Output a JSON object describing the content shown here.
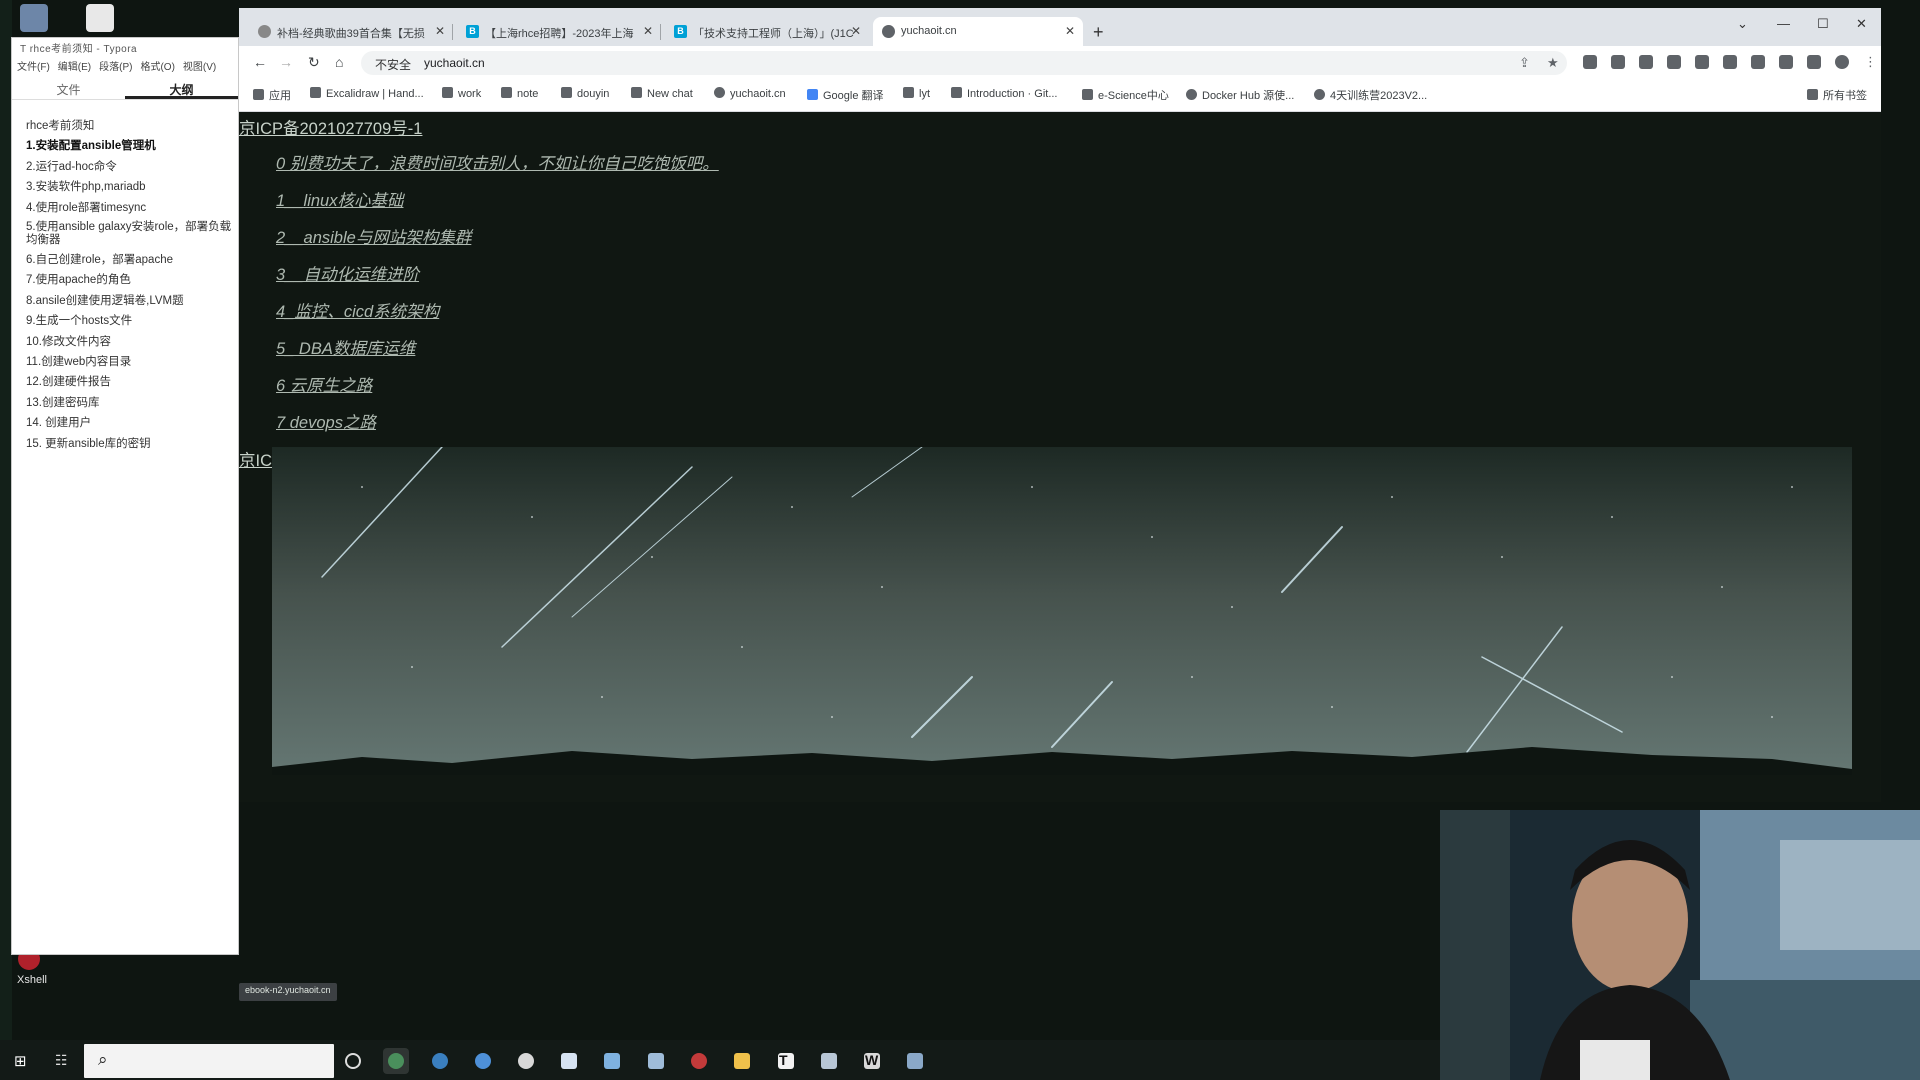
{
  "desktop": {
    "icons": [
      {
        "name": "recycle-bin-icon"
      },
      {
        "name": "document-icon"
      },
      {
        "name": "xshell-icon",
        "label": "Xshell"
      }
    ]
  },
  "typora": {
    "title": "T rhce考前须知 - Typora",
    "menu": [
      "文件(F)",
      "编辑(E)",
      "段落(P)",
      "格式(O)",
      "视图(V)"
    ],
    "tabs": {
      "files": "文件",
      "outline": "大纲"
    },
    "outline": [
      "rhce考前须知",
      "1.安装配置ansible管理机",
      "2.运行ad-hoc命令",
      "3.安装软件php,mariadb",
      "4.使用role部署timesync",
      "5.使用ansible galaxy安装role，部署负载均衡器",
      "6.自己创建role，部署apache",
      "7.使用apache的角色",
      "8.ansile创建使用逻辑卷,LVM题",
      "9.生成一个hosts文件",
      "10.修改文件内容",
      "11.创建web内容目录",
      "12.创建硬件报告",
      "13.创建密码库",
      "14. 创建用户",
      "15. 更新ansible库的密钥"
    ]
  },
  "browser": {
    "tabs": [
      {
        "title": "补档-经典歌曲39首合集【无损",
        "icon": "bilibili-icon"
      },
      {
        "title": "【上海rhce招聘】-2023年上海",
        "icon": "bilibili-icon"
      },
      {
        "title": "「技术支持工程师（上海）」(J1C",
        "icon": "bilibili-icon"
      },
      {
        "title": "yuchaoit.cn",
        "icon": "globe-icon"
      }
    ],
    "address": {
      "warning": "不安全",
      "url": "yuchaoit.cn"
    },
    "bookmarks": [
      "应用",
      "Excalidraw | Hand...",
      "work",
      "note",
      "douyin",
      "New chat",
      "yuchaoit.cn",
      "Google 翻译",
      "lyt",
      "Introduction · Git...",
      "e-Science中心",
      "Docker Hub 源使...",
      "4天训练营2023V2..."
    ],
    "all_bookmarks": "所有书签"
  },
  "page": {
    "icp": "京ICP备2021027709号-1",
    "icp_partial": "京IC",
    "links": [
      "0 别费功夫了，浪费时间攻击别人，不如让你自己吃饱饭吧。",
      "1__linux核心基础",
      "2__ansible与网站架构集群",
      "3__自动化运维进阶",
      "4_监控、cicd系统架构",
      "5_ DBA数据库运维",
      "6 云原生之路",
      "7 devops之路"
    ]
  },
  "status": {
    "hover_url": "ebook-n2.yuchaoit.cn"
  },
  "taskbar": {
    "search_placeholder": "",
    "apps": [
      {
        "name": "taskbar-cortana-icon"
      },
      {
        "name": "taskbar-chrome-icon"
      },
      {
        "name": "taskbar-edge-icon"
      },
      {
        "name": "taskbar-safari-icon"
      },
      {
        "name": "taskbar-wechat-icon"
      },
      {
        "name": "taskbar-outlook-icon"
      },
      {
        "name": "taskbar-notepad-icon"
      },
      {
        "name": "taskbar-grid-icon"
      },
      {
        "name": "taskbar-xshell-icon"
      },
      {
        "name": "taskbar-explorer-icon"
      },
      {
        "name": "taskbar-typora-icon",
        "glyph": "T"
      },
      {
        "name": "taskbar-vm-icon"
      },
      {
        "name": "taskbar-wps-icon",
        "glyph": "W"
      },
      {
        "name": "taskbar-app-icon"
      }
    ]
  },
  "colors": {
    "page_bg": "#101712",
    "link": "#aeb9b0",
    "chrome_tab": "#dfe3e8",
    "taskbar": "#131a17"
  }
}
